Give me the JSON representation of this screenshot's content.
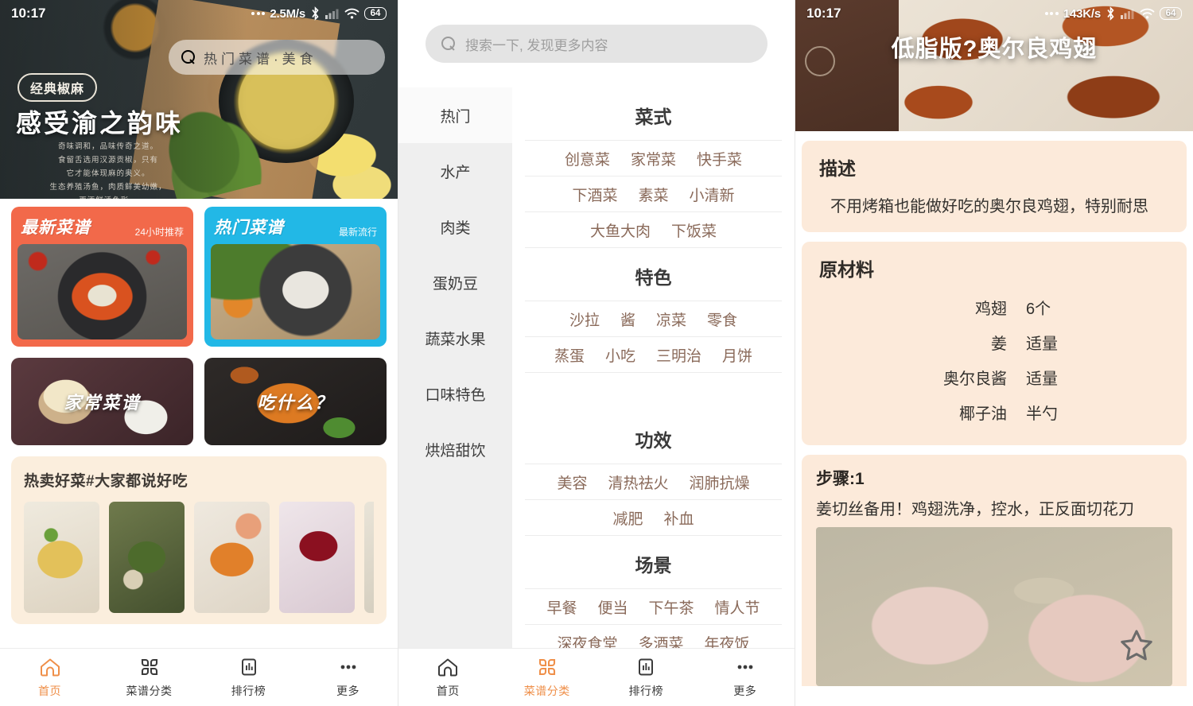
{
  "screens": {
    "home": {
      "status": {
        "time": "10:17",
        "speed": "2.5M/s",
        "battery": "64"
      },
      "hero": {
        "tag": "经典椒麻",
        "title": "感受渝之韵味",
        "lines": "奇味调和，品味传奇之道。\n食留舌选用汉源贡椒，只有\n它才能体现麻的奥义。\n生态养殖汤鱼，肉质鲜美幼嫩，\n更添鲜活色彩。",
        "search_text": "热门菜谱·美食"
      },
      "cards": [
        {
          "title": "最新菜谱",
          "sub": "24小时推荐"
        },
        {
          "title": "热门菜谱",
          "sub": "最新流行"
        }
      ],
      "small_cards": [
        {
          "label": "家常菜谱"
        },
        {
          "label": "吃什么？"
        }
      ],
      "hot": {
        "title": "热卖好菜#大家都说好吃"
      },
      "tabs": [
        {
          "label": "首页",
          "icon": "home-icon",
          "active": true
        },
        {
          "label": "菜谱分类",
          "icon": "grid-icon",
          "active": false
        },
        {
          "label": "排行榜",
          "icon": "chart-icon",
          "active": false
        },
        {
          "label": "更多",
          "icon": "more-icon",
          "active": false
        }
      ]
    },
    "category": {
      "status": {
        "time": "",
        "speed": "",
        "battery": ""
      },
      "search_placeholder": "搜索一下, 发现更多内容",
      "sidebar": [
        {
          "label": "热门",
          "active": true
        },
        {
          "label": "水产",
          "active": false
        },
        {
          "label": "肉类",
          "active": false
        },
        {
          "label": "蛋奶豆",
          "active": false
        },
        {
          "label": "蔬菜水果",
          "active": false
        },
        {
          "label": "口味特色",
          "active": false
        },
        {
          "label": "烘焙甜饮",
          "active": false
        }
      ],
      "groups": [
        {
          "title": "菜式",
          "rows": [
            [
              "创意菜",
              "家常菜",
              "快手菜"
            ],
            [
              "下酒菜",
              "素菜",
              "小清新"
            ],
            [
              "大鱼大肉",
              "下饭菜"
            ]
          ]
        },
        {
          "title": "特色",
          "rows": [
            [
              "沙拉",
              "酱",
              "凉菜",
              "零食"
            ],
            [
              "蒸蛋",
              "小吃",
              "三明治",
              "月饼"
            ]
          ]
        },
        {
          "title": "功效",
          "rows": [
            [
              "美容",
              "清热祛火",
              "润肺抗燥"
            ],
            [
              "减肥",
              "补血"
            ]
          ]
        },
        {
          "title": "场景",
          "rows": [
            [
              "早餐",
              "便当",
              "下午茶",
              "情人节"
            ],
            [
              "深夜食堂",
              "多酒菜",
              "年夜饭"
            ]
          ]
        }
      ],
      "tabs": [
        {
          "label": "首页",
          "icon": "home-icon",
          "active": false
        },
        {
          "label": "菜谱分类",
          "icon": "grid-icon",
          "active": true
        },
        {
          "label": "排行榜",
          "icon": "chart-icon",
          "active": false
        },
        {
          "label": "更多",
          "icon": "more-icon",
          "active": false
        }
      ]
    },
    "recipe": {
      "status": {
        "time": "10:17",
        "speed": "143K/s",
        "battery": "64"
      },
      "title": "低脂版?奥尔良鸡翅",
      "description": {
        "heading": "描述",
        "text": "不用烤箱也能做好吃的奥尔良鸡翅，特别耐思"
      },
      "ingredients": {
        "heading": "原材料",
        "items": [
          {
            "name": "鸡翅",
            "amount": "6个"
          },
          {
            "name": "姜",
            "amount": "适量"
          },
          {
            "name": "奥尔良酱",
            "amount": "适量"
          },
          {
            "name": "椰子油",
            "amount": "半勺"
          }
        ]
      },
      "step": {
        "heading": "步骤:1",
        "text": "姜切丝备用！鸡翅洗净，控水，正反面切花刀"
      },
      "favorite_icon": "star-icon"
    }
  },
  "colors": {
    "accent_orange": "#ef8f49",
    "card_orange": "#f2694a",
    "card_blue": "#22b8e6",
    "beige": "#fceada",
    "tag_brown": "#8a6a5a"
  }
}
